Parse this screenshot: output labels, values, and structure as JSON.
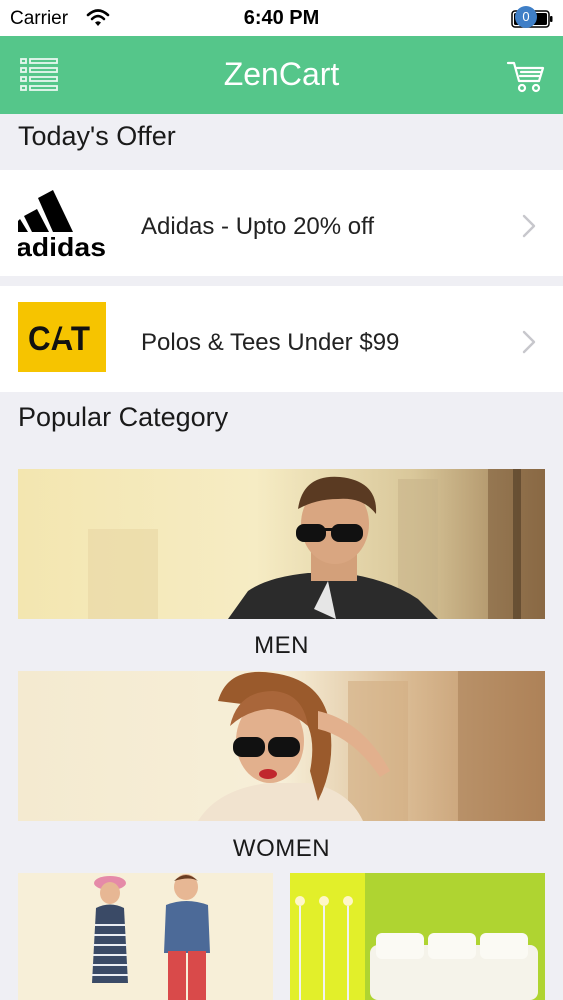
{
  "status_bar": {
    "carrier": "Carrier",
    "time": "6:40 PM"
  },
  "nav": {
    "title": "ZenCart",
    "cart_count": "0",
    "accent_color": "#55c68a",
    "badge_color": "#3f7fc7"
  },
  "todays_offer": {
    "title": "Today's Offer",
    "items": [
      {
        "brand_icon": "adidas-logo",
        "brand_text": "adidas",
        "label": "Adidas - Upto  20% off"
      },
      {
        "brand_icon": "cat-logo",
        "brand_text": "CAT",
        "label": "Polos & Tees Under $99"
      }
    ]
  },
  "popular_category": {
    "title": "Popular Category",
    "items": [
      {
        "label": "MEN",
        "image": "men-banner-image"
      },
      {
        "label": "WOMEN",
        "image": "women-banner-image"
      }
    ],
    "tiles": [
      {
        "image": "kids-tile-image"
      },
      {
        "image": "home-decor-tile-image"
      }
    ]
  }
}
